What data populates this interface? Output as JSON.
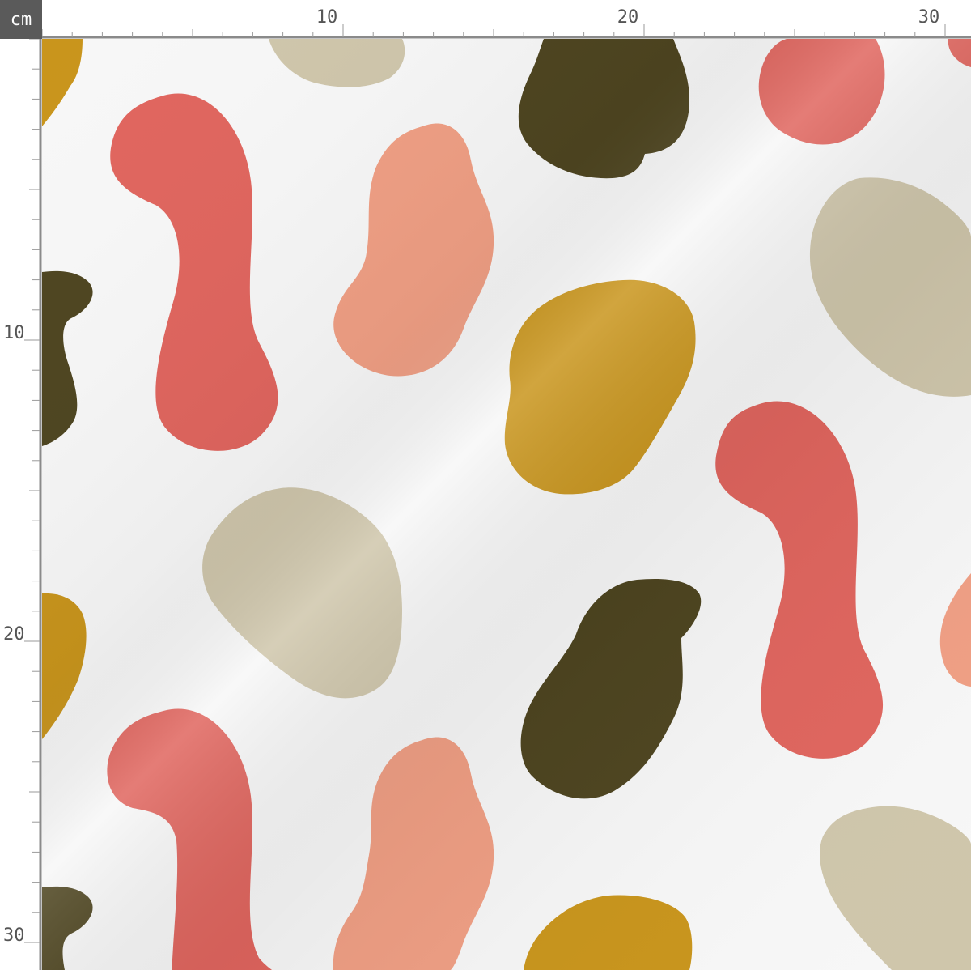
{
  "ruler": {
    "unit": "cm",
    "top_labels": [
      "10",
      "20",
      "30"
    ],
    "left_labels": [
      "10",
      "20",
      "30"
    ]
  },
  "palette": {
    "coral": "#e0655e",
    "peach": "#f09f84",
    "olive": "#4e4520",
    "mustard": "#c9951c",
    "beige": "#cfc6ab",
    "background": "#f7f7f7"
  }
}
